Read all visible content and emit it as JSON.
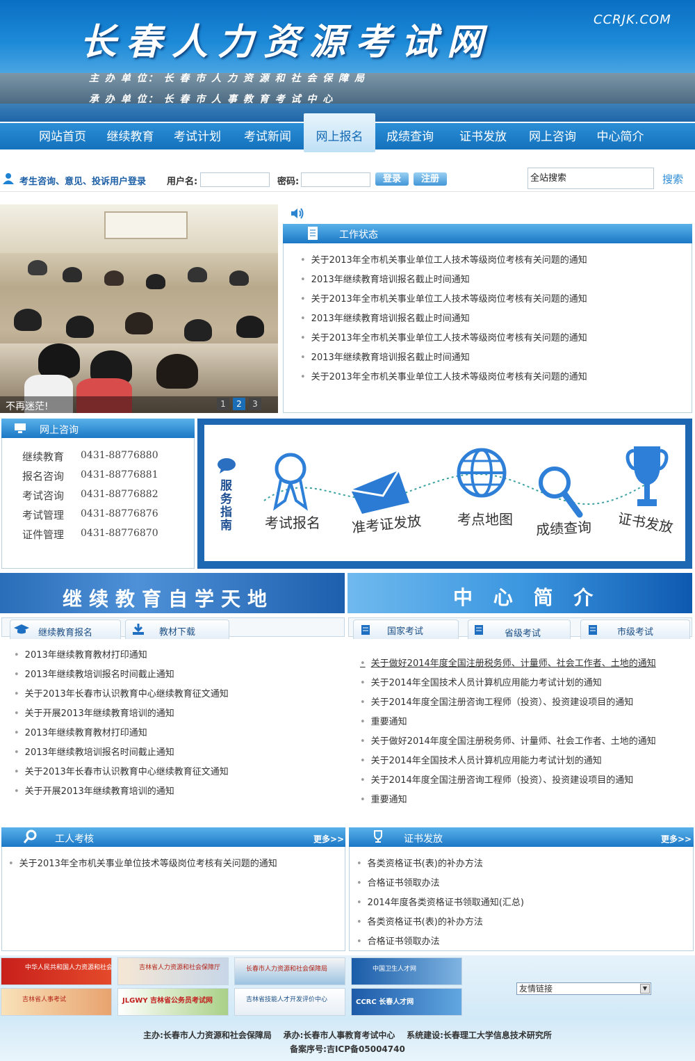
{
  "header": {
    "title": "长春人力资源考试网",
    "domain": "CCRJK.COM",
    "host": "主 办 单 位： 长 春 市 人 力 资 源 和 社 会 保 障 局",
    "organizer": "承 办 单 位： 长 春 市 人 事 教 育 考 试 中 心"
  },
  "nav": {
    "items": [
      "网站首页",
      "继续教育",
      "考试计划",
      "考试新闻",
      "网上报名",
      "成绩查询",
      "证书发放",
      "网上咨询",
      "中心简介"
    ],
    "active_index": 4
  },
  "login": {
    "prompt": "考生咨询、意见、投诉用户登录",
    "username_label": "用户名:",
    "password_label": "密码:",
    "login_button": "登录",
    "register_button": "注册",
    "search_value": "全站搜索",
    "search_button": "搜索"
  },
  "slider": {
    "caption": "不再迷茫!",
    "pages": [
      "1",
      "2",
      "3"
    ],
    "active_page": 1
  },
  "work_status": {
    "title": "工作状态",
    "items": [
      "关于2013年全市机关事业单位工人技术等级岗位考核有关问题的通知",
      "2013年继续教育培训报名截止时间通知",
      "关于2013年全市机关事业单位工人技术等级岗位考核有关问题的通知",
      "2013年继续教育培训报名截止时间通知",
      "关于2013年全市机关事业单位工人技术等级岗位考核有关问题的通知",
      "2013年继续教育培训报名截止时间通知",
      "关于2013年全市机关事业单位工人技术等级岗位考核有关问题的通知"
    ]
  },
  "consult": {
    "title": "网上咨询",
    "rows": [
      {
        "label": "继续教育",
        "phone": "0431-88776880"
      },
      {
        "label": "报名咨询",
        "phone": "0431-88776881"
      },
      {
        "label": "考试咨询",
        "phone": "0431-88776882"
      },
      {
        "label": "考试管理",
        "phone": "0431-88776876"
      },
      {
        "label": "证件管理",
        "phone": "0431-88776870"
      }
    ]
  },
  "service_guide": {
    "title": "服务指南",
    "steps": [
      "考试报名",
      "准考证发放",
      "考点地图",
      "成绩查询",
      "证书发放"
    ]
  },
  "banners": {
    "left": "继续教育自学天地",
    "right": "中 心 简 介"
  },
  "edu": {
    "tabs": [
      "继续教育报名",
      "教材下载"
    ],
    "items": [
      "2013年继续教育教材打印通知",
      "2013年继续教培训报名时间截止通知",
      "关于2013年长春市认识教育中心继续教育征文通知",
      "关于开展2013年继续教育培训的通知",
      "2013年继续教育教材打印通知",
      "2013年继续教培训报名时间截止通知",
      "关于2013年长春市认识教育中心继续教育征文通知",
      "关于开展2013年继续教育培训的通知"
    ]
  },
  "exam": {
    "tabs": [
      "国家考试",
      "省级考试",
      "市级考试"
    ],
    "items": [
      "关于做好2014年度全国注册税务师、计量师、社会工作者、土地的通知",
      "关于2014年全国技术人员计算机应用能力考试计划的通知",
      "关于2014年度全国注册咨询工程师（投资）、投资建设项目的通知",
      "重要通知",
      "关于做好2014年度全国注册税务师、计量师、社会工作者、土地的通知",
      "关于2014年全国技术人员计算机应用能力考试计划的通知",
      "关于2014年度全国注册咨询工程师（投资）、投资建设项目的通知",
      "重要通知"
    ]
  },
  "worker": {
    "title": "工人考核",
    "more": "更多>>",
    "items": [
      "关于2013年全市机关事业单位技术等级岗位考核有关问题的通知"
    ]
  },
  "cert": {
    "title": "证书发放",
    "more": "更多>>",
    "items": [
      "各类资格证书(表)的补办方法",
      "合格证书领取办法",
      "2014年度各类资格证书领取通知(汇总)",
      "各类资格证书(表)的补办方法",
      "合格证书领取办法"
    ]
  },
  "links": {
    "logos": [
      "中华人民共和国人力资源和社会保障部",
      "吉林省人力资源和社会保障厅",
      "长春市人力资源和社会保障局",
      "中国卫生人才网",
      "吉林省人事考试",
      "JLGWY 吉林省公务员考试网",
      "吉林省技能人才开发评价中心",
      "CCRC 长春人才网"
    ],
    "select_label": "友情链接"
  },
  "footer": {
    "line1": "主办:长春市人力资源和社会保障局    承办:长春市人事教育考试中心    系统建设:长春理工大学信息技术研究所",
    "line2": "备案序号:吉ICP备05004740"
  }
}
